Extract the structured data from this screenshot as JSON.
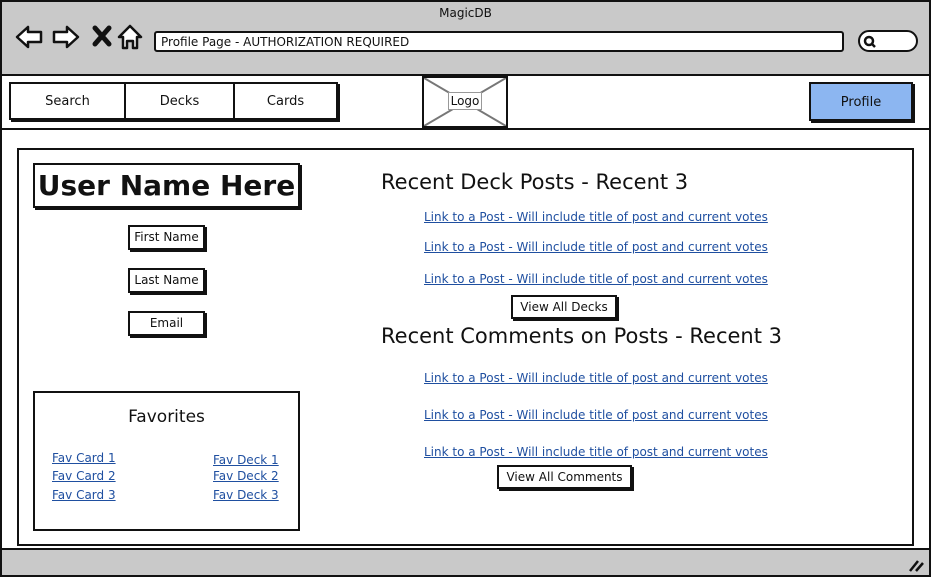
{
  "window": {
    "title": "MagicDB"
  },
  "browser": {
    "address": "Profile Page - AUTHORIZATION REQUIRED"
  },
  "nav": {
    "tabs": [
      "Search",
      "Decks",
      "Cards"
    ],
    "logo_label": "Logo",
    "profile_label": "Profile"
  },
  "profile": {
    "username": "User Name Here",
    "fields": [
      "First Name",
      "Last Name",
      "Email"
    ]
  },
  "favorites": {
    "title": "Favorites",
    "cards": [
      "Fav Card 1",
      "Fav Card 2",
      "Fav Card 3"
    ],
    "decks": [
      "Fav Deck 1",
      "Fav Deck 2",
      "Fav Deck 3"
    ]
  },
  "deck_posts": {
    "heading": "Recent Deck Posts -  Recent 3",
    "links": [
      "Link to a Post - Will include title of post and current votes",
      "Link to a Post - Will include title of post and current votes",
      "Link to a Post - Will include title of post and current votes"
    ],
    "button": "View All Decks"
  },
  "comments": {
    "heading": "Recent Comments on Posts -  Recent 3",
    "links": [
      "Link to a Post - Will include title of post and current votes",
      "Link to a Post - Will include title of post and current votes",
      "Link to a Post - Will include title of post and current votes"
    ],
    "button": "View All Comments"
  },
  "colors": {
    "chrome": "#c9c9c9",
    "profile_button": "#8cb6f1",
    "link": "#1f4fa0"
  }
}
